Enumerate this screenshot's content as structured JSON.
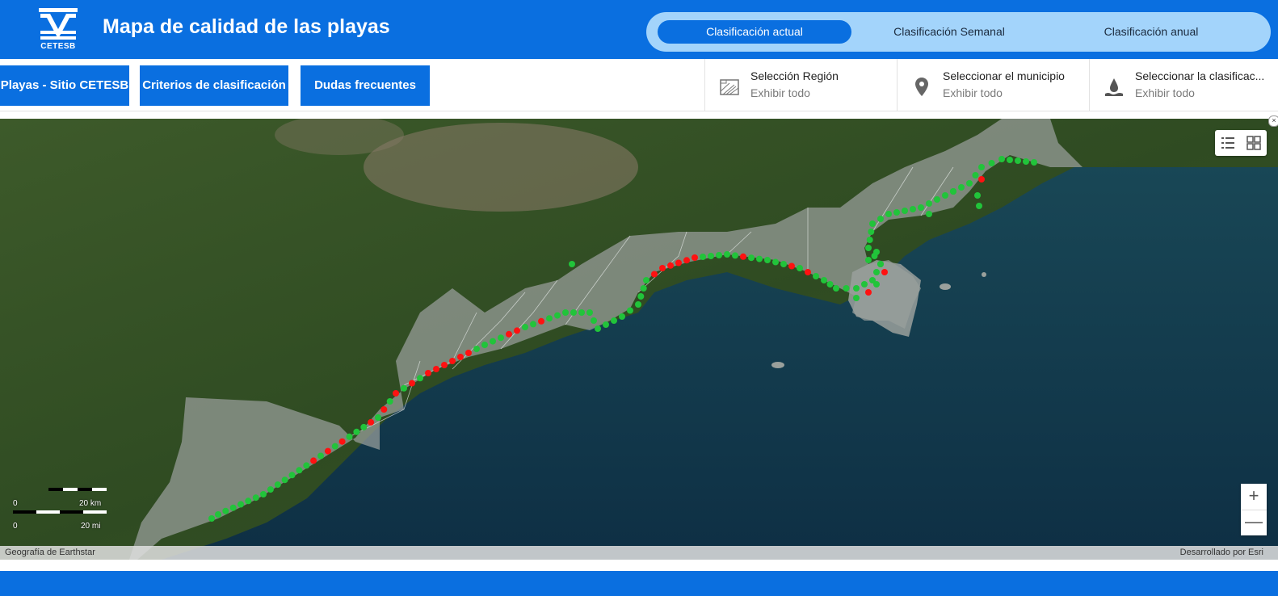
{
  "header": {
    "logo_text": "CETESB",
    "title": "Mapa de calidad de las playas",
    "tabs": [
      {
        "label": "Clasificación actual",
        "active": true
      },
      {
        "label": "Clasificación Semanal",
        "active": false
      },
      {
        "label": "Clasificación anual",
        "active": false
      }
    ]
  },
  "toolbar": {
    "buttons": [
      {
        "label": "Playas - Sitio CETESB"
      },
      {
        "label": "Criterios de clasificación"
      },
      {
        "label": "Dudas frecuentes"
      }
    ],
    "filters": [
      {
        "title": "Selección Región",
        "value": "Exhibir todo",
        "icon": "region-map-icon"
      },
      {
        "title": "Seleccionar el municipio",
        "value": "Exhibir todo",
        "icon": "location-pin-icon"
      },
      {
        "title": "Seleccionar la clasificac...",
        "value": "Exhibir todo",
        "icon": "water-drop-icon"
      }
    ]
  },
  "map": {
    "attribution_left": "Geografía de Earthstar",
    "attribution_right": "Desarrollado por Esri",
    "scale": {
      "km_start": "0",
      "km_end": "20 km",
      "mi_start": "0",
      "mi_end": "20 mi"
    },
    "zoom_in": "+",
    "zoom_out": "—",
    "close": "×",
    "legend_colors": {
      "good": "#21c43a",
      "bad": "#ff1111"
    }
  },
  "colors": {
    "brand": "#0a6fe0",
    "segment_bg": "#a3d4fb"
  }
}
